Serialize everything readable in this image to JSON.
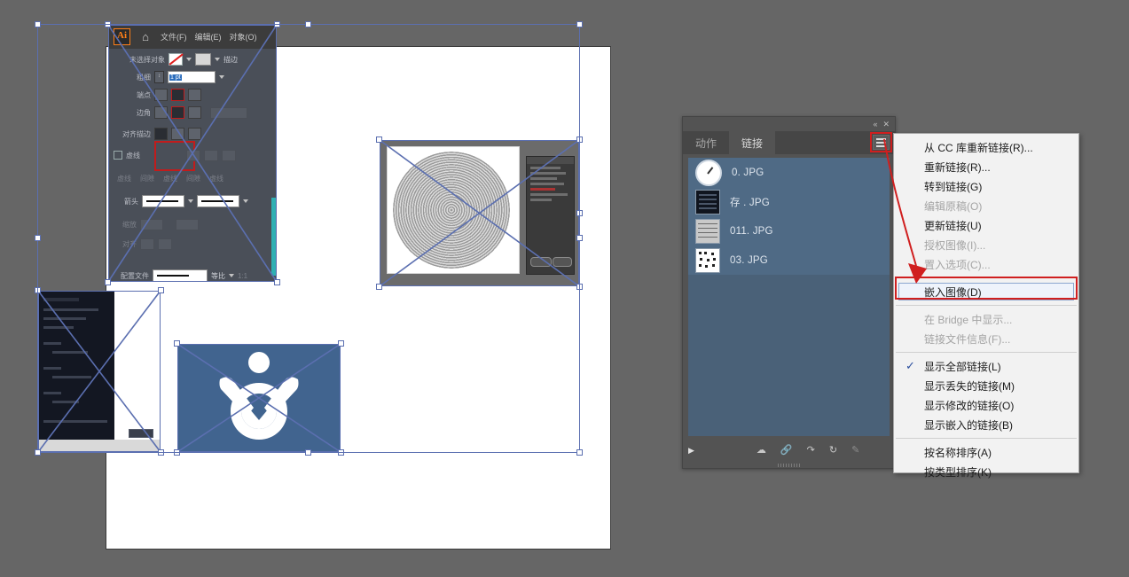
{
  "app": {
    "canvas_bg": "#666666",
    "artboard_bg": "#ffffff",
    "selection_color": "#5b6fb0",
    "accent_red": "#d01f1f"
  },
  "embedded_ai_screenshot": {
    "logo": "Ai",
    "home_icon": "home-icon",
    "menu": [
      {
        "label": "文件(F)"
      },
      {
        "label": "编辑(E)"
      },
      {
        "label": "对象(O)"
      }
    ],
    "control_bar": {
      "no_selection_label": "未选择对象",
      "stroke_label": "描边",
      "weight_label": "粗细",
      "weight_value": "1 pt",
      "cap_label": "端点",
      "corner_label": "边角",
      "align_stroke_label": "对齐描边",
      "dashed_label": "虚线",
      "dash_fields": [
        "虚线",
        "间隙",
        "虚线",
        "间隙",
        "虚线"
      ],
      "arrowheads_label": "箭头",
      "scale_label": "缩放",
      "align_label": "对齐",
      "profile_label": "配置文件",
      "profile_value": "等比",
      "profile_extra": "1:1"
    }
  },
  "embedded_circles_image": {
    "name": "concentric-rings-artwork"
  },
  "embedded_dark_dialog": {
    "name": "dark-dialog-screenshot"
  },
  "embedded_logo_image": {
    "name": "blue-logo-artwork",
    "background": "#41648f"
  },
  "links_panel": {
    "titlebar": {
      "collapse_icon": "«",
      "close_icon": "✕"
    },
    "tabs": [
      {
        "label": "动作",
        "active": false
      },
      {
        "label": "链接",
        "active": true
      }
    ],
    "menu_button_icon": "hamburger-icon",
    "items": [
      {
        "name": "0. JPG",
        "thumb": "clock-thumb",
        "selected": true
      },
      {
        "name": "存 . JPG",
        "thumb": "dark-thumb",
        "selected": true
      },
      {
        "name": "011. JPG",
        "thumb": "doc-thumb",
        "selected": true
      },
      {
        "name": "03. JPG",
        "thumb": "qr-thumb",
        "selected": true
      }
    ],
    "footer": {
      "expand_icon": "▶",
      "buttons": [
        {
          "icon": "relink-icon",
          "enabled": true
        },
        {
          "icon": "go-to-link-icon",
          "enabled": true
        },
        {
          "icon": "update-link-icon",
          "enabled": true
        },
        {
          "icon": "refresh-icon",
          "enabled": true
        },
        {
          "icon": "edit-original-icon",
          "enabled": false
        }
      ]
    }
  },
  "flyout_menu": {
    "items": [
      {
        "label": "从 CC 库重新链接(R)...",
        "disabled": false,
        "checked": false
      },
      {
        "label": "重新链接(R)...",
        "disabled": false,
        "checked": false
      },
      {
        "label": "转到链接(G)",
        "disabled": false,
        "checked": false
      },
      {
        "label": "编辑原稿(O)",
        "disabled": true,
        "checked": false
      },
      {
        "label": "更新链接(U)",
        "disabled": false,
        "checked": false
      },
      {
        "label": "授权图像(I)...",
        "disabled": true,
        "checked": false
      },
      {
        "label": "置入选项(C)...",
        "disabled": true,
        "checked": false
      },
      {
        "separator": true
      },
      {
        "label": "嵌入图像(D)",
        "disabled": false,
        "checked": false,
        "highlighted": true
      },
      {
        "separator": true
      },
      {
        "label": "在 Bridge 中显示...",
        "disabled": true,
        "checked": false
      },
      {
        "label": "链接文件信息(F)...",
        "disabled": true,
        "checked": false
      },
      {
        "separator": true
      },
      {
        "label": "显示全部链接(L)",
        "disabled": false,
        "checked": true
      },
      {
        "label": "显示丢失的链接(M)",
        "disabled": false,
        "checked": false
      },
      {
        "label": "显示修改的链接(O)",
        "disabled": false,
        "checked": false
      },
      {
        "label": "显示嵌入的链接(B)",
        "disabled": false,
        "checked": false
      },
      {
        "separator": true
      },
      {
        "label": "按名称排序(A)",
        "disabled": false,
        "checked": false
      },
      {
        "label": "按类型排序(K)",
        "disabled": false,
        "checked": false
      }
    ],
    "check_glyph": "✓"
  }
}
